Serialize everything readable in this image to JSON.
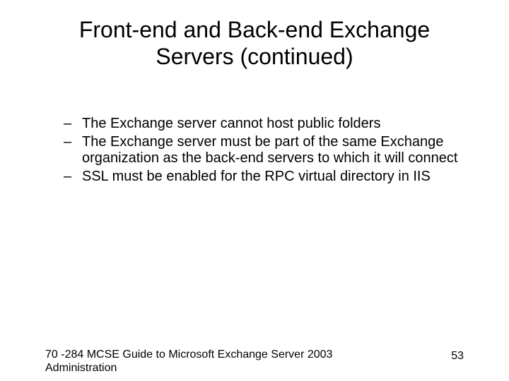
{
  "title": "Front-end and Back-end Exchange Servers (continued)",
  "bullets": [
    "The Exchange server cannot host public folders",
    "The Exchange server must be part of the same Exchange organization as the back-end servers to which it will connect",
    "SSL must be enabled for the RPC virtual directory in IIS"
  ],
  "footer": {
    "left": "70 -284 MCSE Guide to Microsoft Exchange Server 2003 Administration",
    "right": "53"
  }
}
